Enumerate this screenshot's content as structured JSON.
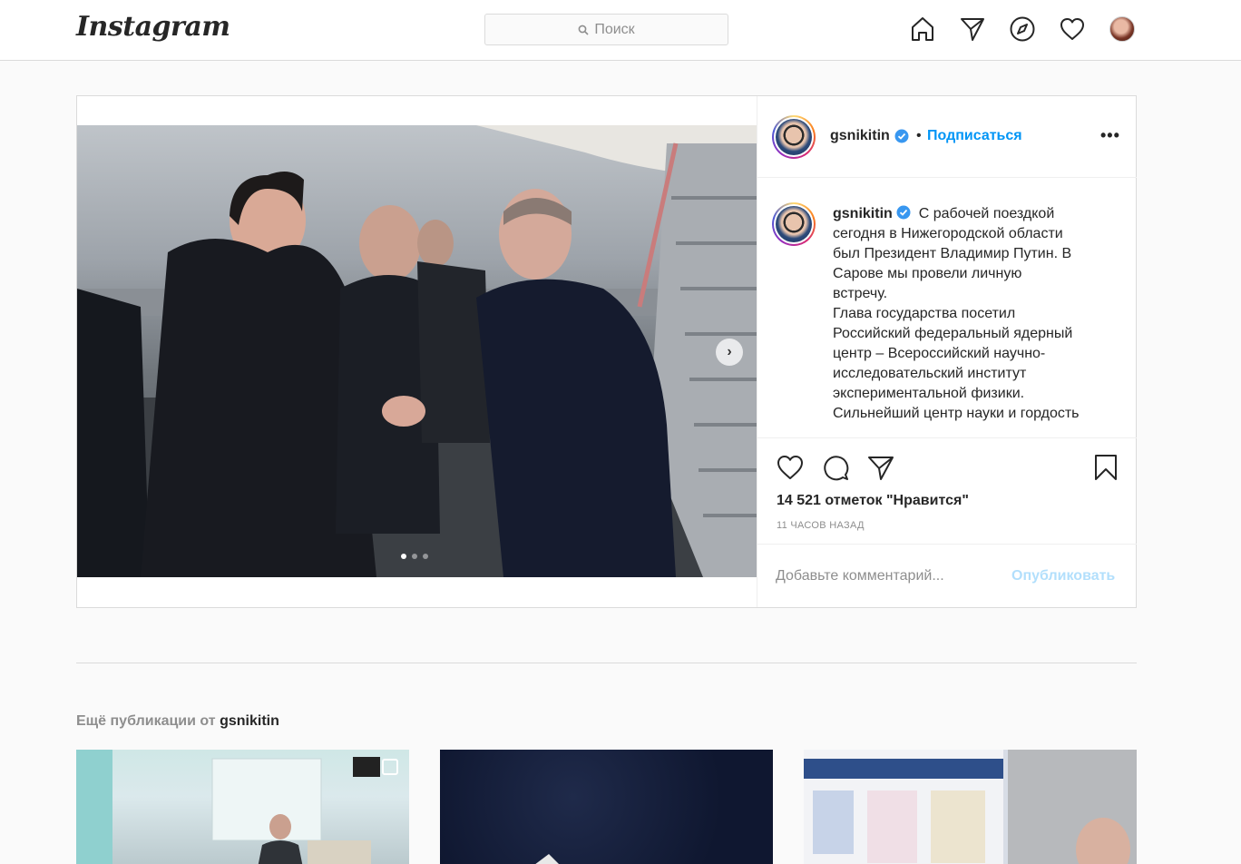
{
  "app": {
    "logo_text": "Instagram"
  },
  "search": {
    "placeholder": "Поиск"
  },
  "nav": {
    "icons": [
      "home-icon",
      "direct-icon",
      "explore-icon",
      "heart-icon",
      "profile-avatar"
    ]
  },
  "post": {
    "username": "gsnikitin",
    "bullet": "•",
    "follow_label": "Подписаться",
    "more_label": "•••",
    "caption_lines": [
      "С рабочей поездкой",
      "сегодня в Нижегородской области",
      "был Президент Владимир Путин. В",
      "Сарове мы провели личную",
      "встречу.",
      "Глава государства посетил",
      "Российский федеральный ядерный",
      "центр – Всероссийский научно-",
      "исследовательский институт",
      "экспериментальной физики.",
      "Сильнейший центр науки и гордость"
    ],
    "likes": "14 521 отметок \"Нравится\"",
    "time": "11 часов назад",
    "comment_placeholder": "Добавьте комментарий...",
    "publish_label": "Опубликовать",
    "carousel": {
      "total": 3,
      "current": 1,
      "next_arrow": "›"
    }
  },
  "more_posts": {
    "prefix": "Ещё публикации от",
    "username": "gsnikitin"
  },
  "colors": {
    "link": "#0095f6",
    "publish_disabled": "#b2dffc",
    "muted": "#8e8e8e",
    "border": "#dbdbdb"
  }
}
